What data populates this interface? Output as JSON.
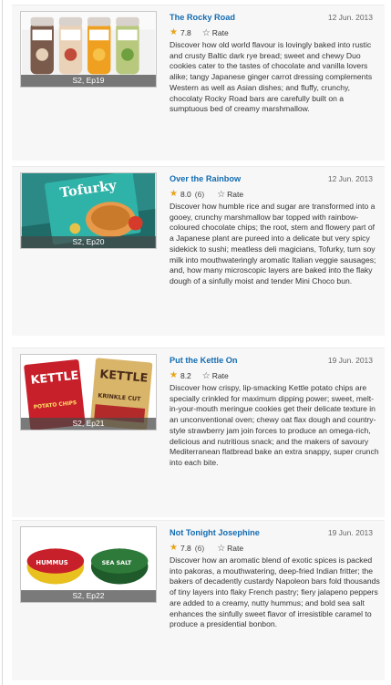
{
  "episodes": [
    {
      "title": "The Rocky Road",
      "date": "12 Jun. 2013",
      "thumb_caption": "S2, Ep19",
      "rating": "7.8",
      "votes": "",
      "rate_label": "Rate",
      "description": "Discover how old world flavour is lovingly baked into rustic and crusty Baltic dark rye bread; sweet and chewy Duo cookies cater to the tastes of chocolate and vanilla lovers alike; tangy Japanese ginger carrot dressing complements Western as well as Asian dishes; and fluffy, crunchy, chocolaty Rocky Road bars are carefully built on a sumptuous bed of creamy marshmallow."
    },
    {
      "title": "Over the Rainbow",
      "date": "12 Jun. 2013",
      "thumb_caption": "S2, Ep20",
      "rating": "8.0",
      "votes": "(6)",
      "rate_label": "Rate",
      "description": "Discover how humble rice and sugar are transformed into a gooey, crunchy marshmallow bar topped with rainbow-coloured chocolate chips; the root, stem and flowery part of a Japanese plant are pureed into a delicate but very spicy sidekick to sushi; meatless deli magicians, Tofurky, turn soy milk into mouthwateringly aromatic Italian veggie sausages; and, how many microscopic layers are baked into the flaky dough of a sinfully moist and tender Mini Choco bun."
    },
    {
      "title": "Put the Kettle On",
      "date": "19 Jun. 2013",
      "thumb_caption": "S2, Ep21",
      "rating": "8.2",
      "votes": "",
      "rate_label": "Rate",
      "description": "Discover how crispy, lip-smacking Kettle potato chips are specially crinkled for maximum dipping power; sweet, melt-in-your-mouth meringue cookies get their delicate texture in an unconventional oven; chewy oat flax dough and country-style strawberry jam join forces to produce an omega-rich, delicious and nutritious snack; and the makers of savoury Mediterranean flatbread bake an extra snappy, super crunch into each bite."
    },
    {
      "title": "Not Tonight Josephine",
      "date": "19 Jun. 2013",
      "thumb_caption": "S2, Ep22",
      "rating": "7.8",
      "votes": "(6)",
      "rate_label": "Rate",
      "description": "Discover how an aromatic blend of exotic spices is packed into pakoras, a mouthwatering, deep-fried Indian fritter; the bakers of decadently custardy Napoleon bars fold thousands of tiny layers into flaky French pastry; fiery jalapeno peppers are added to a creamy, nutty hummus; and bold sea salt enhances the sinfully sweet flavor of irresistible caramel to produce a presidential bonbon."
    }
  ],
  "thumb_texts": {
    "ep20_brand": "Tofurky",
    "ep21_brand": "KETTLE",
    "ep21_left": "POTATO CHIPS",
    "ep21_right": "KRINKLE CUT",
    "ep22_left": "HUMMUS",
    "ep22_right": "SEA SALT"
  },
  "colors": {
    "link": "#136cb2",
    "star": "#e8a317"
  }
}
